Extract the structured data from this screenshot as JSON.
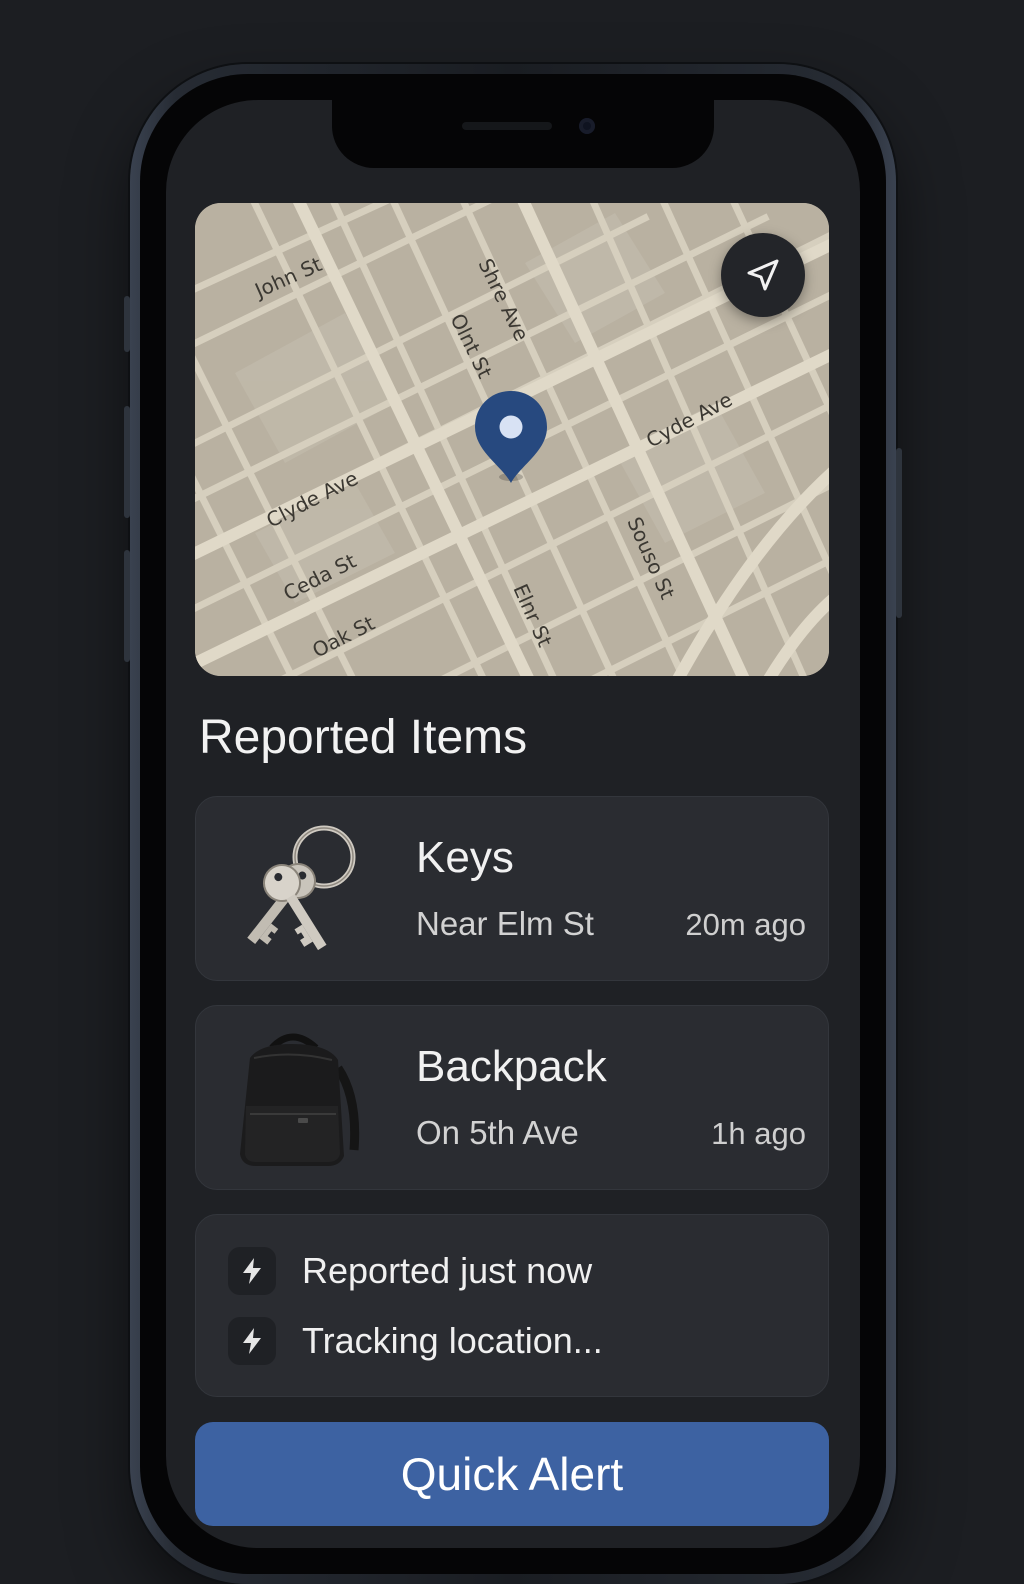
{
  "map": {
    "streets": [
      "John St",
      "Shre Ave",
      "Olnt St",
      "Cyde Ave",
      "Clyde Ave",
      "Ceda St",
      "Oak St",
      "Elnr St",
      "Souso St"
    ],
    "locate_icon": "navigation-arrow-icon",
    "pin_icon": "map-pin-icon"
  },
  "section": {
    "title": "Reported Items"
  },
  "items": [
    {
      "name": "Keys",
      "location": "Near Elm St",
      "time": "20m ago",
      "icon": "keys-icon"
    },
    {
      "name": "Backpack",
      "location": "On 5th Ave",
      "time": "1h ago",
      "icon": "backpack-icon"
    }
  ],
  "activity": [
    {
      "text": "Reported just now",
      "icon": "bolt-icon"
    },
    {
      "text": "Tracking location...",
      "icon": "bolt-icon"
    }
  ],
  "quick_alert": {
    "label": "Quick Alert"
  },
  "colors": {
    "background": "#1c1e22",
    "card": "#2a2c31",
    "map": "#b9b1a1",
    "pin": "#27497f",
    "accent": "#3d62a2"
  }
}
